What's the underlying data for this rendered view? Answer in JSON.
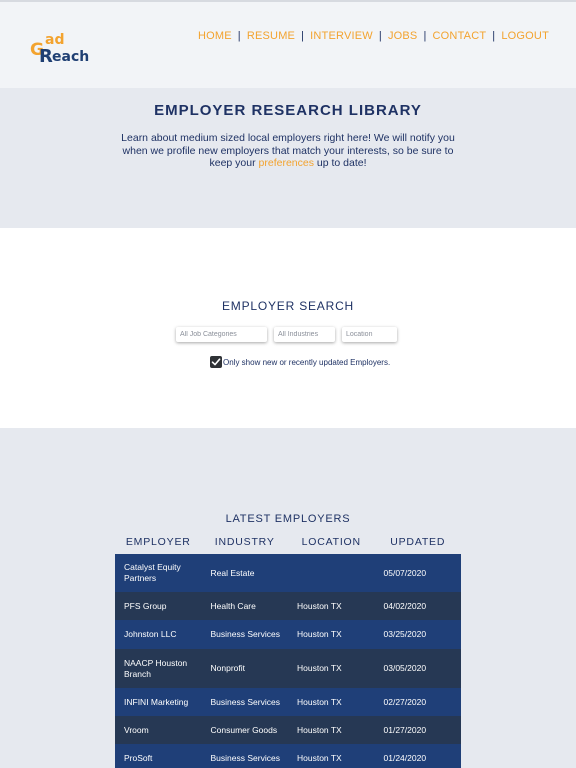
{
  "header": {
    "logo": {
      "g": "G",
      "ad": "ad",
      "r": "R",
      "each": "each"
    },
    "nav": [
      "HOME",
      "RESUME",
      "INTERVIEW",
      "JOBS",
      "CONTACT",
      "LOGOUT"
    ],
    "separator": "|"
  },
  "hero": {
    "title": "EMPLOYER RESEARCH LIBRARY",
    "text_before": "Learn about medium sized local employers right here! We will notify you when we profile new employers that match your interests, so be sure to keep your ",
    "link": "preferences",
    "text_after": " up to date!"
  },
  "search": {
    "title": "EMPLOYER SEARCH",
    "category_placeholder": "All Job Categories",
    "industry_placeholder": "All Industries",
    "location_placeholder": "Location",
    "checkbox_label": "Only show new or recently updated Employers.",
    "checkbox_checked": true
  },
  "latest": {
    "title": "LATEST EMPLOYERS",
    "columns": [
      "EMPLOYER",
      "INDUSTRY",
      "LOCATION",
      "UPDATED"
    ],
    "rows": [
      {
        "employer": "Catalyst Equity Partners",
        "industry": "Real Estate",
        "location": "",
        "updated": "05/07/2020"
      },
      {
        "employer": "PFS Group",
        "industry": "Health Care",
        "location": "Houston TX",
        "updated": "04/02/2020"
      },
      {
        "employer": "Johnston LLC",
        "industry": "Business Services",
        "location": "Houston TX",
        "updated": "03/25/2020"
      },
      {
        "employer": "NAACP Houston Branch",
        "industry": "Nonprofit",
        "location": "Houston TX",
        "updated": "03/05/2020"
      },
      {
        "employer": "INFINI Marketing",
        "industry": "Business Services",
        "location": "Houston TX",
        "updated": "02/27/2020"
      },
      {
        "employer": "Vroom",
        "industry": "Consumer Goods",
        "location": "Houston TX",
        "updated": "01/27/2020"
      },
      {
        "employer": "ProSoft",
        "industry": "Business Services",
        "location": "Houston TX",
        "updated": "01/24/2020"
      }
    ]
  },
  "colors": {
    "accent": "#f3a32f",
    "navy": "#1f3264",
    "row_blue": "#1f3f78",
    "row_dark": "#263854"
  }
}
